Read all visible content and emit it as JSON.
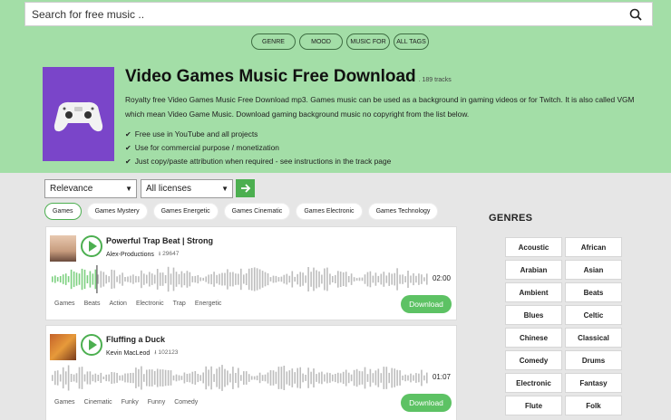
{
  "search": {
    "placeholder": "Search for free music .."
  },
  "nav_chips": [
    {
      "label": "GENRE"
    },
    {
      "label": "MOOD"
    },
    {
      "label": "MUSIC FOR"
    },
    {
      "label": "ALL TAGS"
    }
  ],
  "header": {
    "title": "Video Games Music Free Download",
    "count": ". 189 tracks",
    "description": "Royalty free Video Games Music Free Download mp3. Games music can be used as a background in gaming videos or for Twitch. It is also called VGM which mean Video Game Music. Download gaming background music no copyright from the list below.",
    "bullets": [
      "Free use in YouTube and all projects",
      "Use for commercial purpose / monetization",
      "Just copy/paste attribution when required - see instructions in the track page"
    ]
  },
  "filters": {
    "sort": "Relevance",
    "license": "All licenses"
  },
  "tag_filters": [
    {
      "label": "Games",
      "active": true
    },
    {
      "label": "Games Mystery",
      "active": false
    },
    {
      "label": "Games Energetic",
      "active": false
    },
    {
      "label": "Games Cinematic",
      "active": false
    },
    {
      "label": "Games Electronic",
      "active": false
    },
    {
      "label": "Games Technology",
      "active": false
    }
  ],
  "tracks": [
    {
      "title": "Powerful Trap Beat | Strong",
      "artist": "Alex-Productions",
      "downloads": "29647",
      "duration": "02:00",
      "progress": 0.12,
      "tags": [
        "Games",
        "Beats",
        "Action",
        "Electronic",
        "Trap",
        "Energetic"
      ],
      "download_label": "Download"
    },
    {
      "title": "Fluffing a Duck",
      "artist": "Kevin MacLeod",
      "downloads": "102123",
      "duration": "01:07",
      "progress": 0,
      "tags": [
        "Games",
        "Cinematic",
        "Funky",
        "Funny",
        "Comedy"
      ],
      "download_label": "Download"
    }
  ],
  "genres": {
    "title": "GENRES",
    "items": [
      "Acoustic",
      "African",
      "Arabian",
      "Asian",
      "Ambient",
      "Beats",
      "Blues",
      "Celtic",
      "Chinese",
      "Classical",
      "Comedy",
      "Drums",
      "Electronic",
      "Fantasy",
      "Flute",
      "Folk"
    ]
  },
  "colors": {
    "hero": "#a3dea7",
    "accent": "#4caf50",
    "cover": "#7a45c9"
  }
}
